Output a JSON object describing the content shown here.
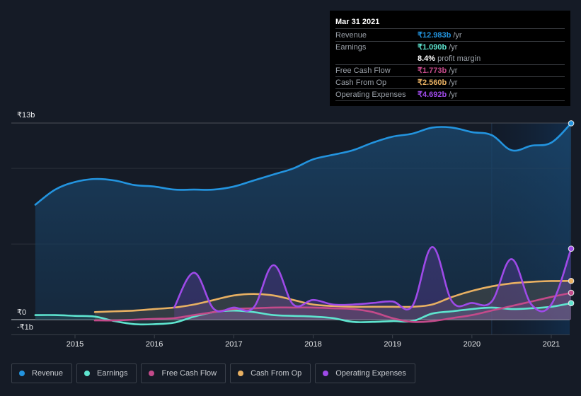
{
  "tooltip": {
    "date": "Mar 31 2021",
    "rows": [
      {
        "label": "Revenue",
        "value": "₹12.983b",
        "unit": "/yr",
        "color": "#2394df"
      },
      {
        "label": "Earnings",
        "value": "₹1.090b",
        "unit": "/yr",
        "color": "#5ee4cf"
      },
      {
        "label": "",
        "value": "8.4%",
        "unit": "profit margin",
        "color": "#ffffff"
      },
      {
        "label": "Free Cash Flow",
        "value": "₹1.773b",
        "unit": "/yr",
        "color": "#c34a8a"
      },
      {
        "label": "Cash From Op",
        "value": "₹2.560b",
        "unit": "/yr",
        "color": "#e8b062"
      },
      {
        "label": "Operating Expenses",
        "value": "₹4.692b",
        "unit": "/yr",
        "color": "#9e4ae8"
      }
    ]
  },
  "chart_data": {
    "type": "area",
    "title": "",
    "xlabel": "",
    "ylabel": "",
    "y_tick_labels": [
      "₹13b",
      "₹0",
      "-₹1b"
    ],
    "x_tick_labels": [
      "2015",
      "2016",
      "2017",
      "2018",
      "2019",
      "2020",
      "2021"
    ],
    "ylim": [
      -1,
      13
    ],
    "xlim": [
      2014.5,
      2021.25
    ],
    "forecast_shade_start": 2020.25,
    "grid": true,
    "legend_position": "bottom-left",
    "series": [
      {
        "name": "Revenue",
        "color": "#2394df",
        "x": [
          2014.5,
          2014.75,
          2015.0,
          2015.25,
          2015.5,
          2015.75,
          2016.0,
          2016.25,
          2016.5,
          2016.75,
          2017.0,
          2017.25,
          2017.5,
          2017.75,
          2018.0,
          2018.25,
          2018.5,
          2018.75,
          2019.0,
          2019.25,
          2019.5,
          2019.75,
          2020.0,
          2020.25,
          2020.5,
          2020.75,
          2021.0,
          2021.25
        ],
        "values": [
          7.6,
          8.6,
          9.1,
          9.3,
          9.2,
          8.9,
          8.8,
          8.6,
          8.6,
          8.6,
          8.8,
          9.2,
          9.6,
          10.0,
          10.6,
          10.9,
          11.2,
          11.7,
          12.1,
          12.3,
          12.7,
          12.7,
          12.4,
          12.2,
          11.2,
          11.5,
          11.7,
          12.983
        ]
      },
      {
        "name": "Earnings",
        "color": "#5ee4cf",
        "x": [
          2014.5,
          2014.75,
          2015.0,
          2015.25,
          2015.5,
          2015.75,
          2016.0,
          2016.25,
          2016.5,
          2016.75,
          2017.0,
          2017.25,
          2017.5,
          2017.75,
          2018.0,
          2018.25,
          2018.5,
          2018.75,
          2019.0,
          2019.25,
          2019.5,
          2019.75,
          2020.0,
          2020.25,
          2020.5,
          2020.75,
          2021.0,
          2021.25
        ],
        "values": [
          0.3,
          0.3,
          0.25,
          0.2,
          -0.1,
          -0.3,
          -0.3,
          -0.2,
          0.2,
          0.5,
          0.6,
          0.5,
          0.3,
          0.25,
          0.2,
          0.1,
          -0.15,
          -0.15,
          -0.1,
          -0.1,
          0.4,
          0.55,
          0.7,
          0.8,
          0.7,
          0.75,
          0.85,
          1.09
        ]
      },
      {
        "name": "Free Cash Flow",
        "color": "#c34a8a",
        "x": [
          2015.25,
          2015.5,
          2015.75,
          2016.0,
          2016.25,
          2016.5,
          2016.75,
          2017.0,
          2017.25,
          2017.5,
          2017.75,
          2018.0,
          2018.25,
          2018.5,
          2018.75,
          2019.0,
          2019.25,
          2019.5,
          2019.75,
          2020.0,
          2020.25,
          2020.5,
          2020.75,
          2021.0,
          2021.25
        ],
        "values": [
          -0.05,
          -0.05,
          0.0,
          0.05,
          0.1,
          0.3,
          0.5,
          0.7,
          0.75,
          0.8,
          0.8,
          0.8,
          0.75,
          0.7,
          0.5,
          0.1,
          -0.15,
          -0.1,
          0.1,
          0.3,
          0.6,
          0.9,
          1.2,
          1.5,
          1.773
        ]
      },
      {
        "name": "Cash From Op",
        "color": "#e8b062",
        "x": [
          2015.25,
          2015.5,
          2015.75,
          2016.0,
          2016.25,
          2016.5,
          2016.75,
          2017.0,
          2017.25,
          2017.5,
          2017.75,
          2018.0,
          2018.25,
          2018.5,
          2018.75,
          2019.0,
          2019.25,
          2019.5,
          2019.75,
          2020.0,
          2020.25,
          2020.5,
          2020.75,
          2021.0,
          2021.25
        ],
        "values": [
          0.5,
          0.55,
          0.6,
          0.7,
          0.8,
          1.0,
          1.3,
          1.6,
          1.7,
          1.6,
          1.3,
          1.0,
          0.9,
          0.85,
          0.85,
          0.85,
          0.85,
          1.0,
          1.5,
          1.9,
          2.2,
          2.4,
          2.5,
          2.55,
          2.56
        ]
      },
      {
        "name": "Operating Expenses",
        "color": "#9e4ae8",
        "x": [
          2016.25,
          2016.5,
          2016.75,
          2017.0,
          2017.25,
          2017.5,
          2017.75,
          2018.0,
          2018.25,
          2018.5,
          2018.75,
          2019.0,
          2019.25,
          2019.5,
          2019.75,
          2020.0,
          2020.25,
          2020.5,
          2020.75,
          2021.0,
          2021.25
        ],
        "values": [
          0.8,
          3.1,
          0.7,
          0.8,
          0.8,
          3.6,
          1.0,
          1.3,
          1.0,
          1.0,
          1.1,
          1.2,
          0.9,
          4.8,
          1.2,
          1.1,
          1.2,
          4.0,
          1.0,
          1.0,
          4.692
        ]
      }
    ]
  },
  "legend": [
    {
      "label": "Revenue",
      "color": "#2394df"
    },
    {
      "label": "Earnings",
      "color": "#5ee4cf"
    },
    {
      "label": "Free Cash Flow",
      "color": "#c34a8a"
    },
    {
      "label": "Cash From Op",
      "color": "#e8b062"
    },
    {
      "label": "Operating Expenses",
      "color": "#9e4ae8"
    }
  ]
}
